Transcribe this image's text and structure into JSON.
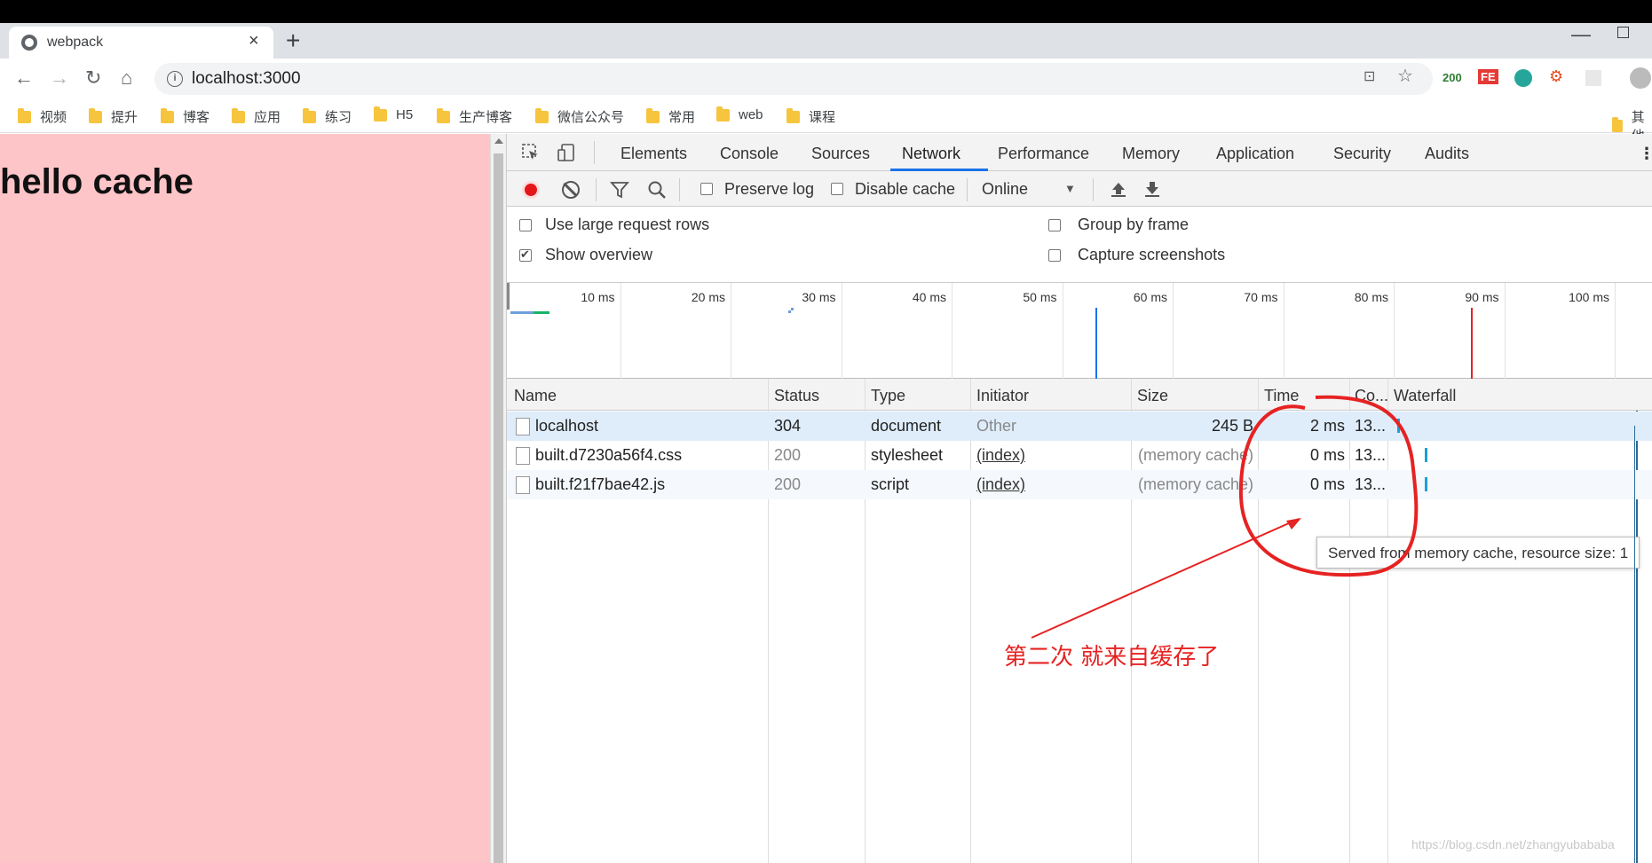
{
  "browser": {
    "tab_title": "webpack",
    "tab_close": "×",
    "new_tab": "+",
    "url": "localhost:3000",
    "ext_count": "200",
    "ext_fe": "FE"
  },
  "bookmarks": [
    "视频",
    "提升",
    "博客",
    "应用",
    "练习",
    "H5",
    "生产博客",
    "微信公众号",
    "常用",
    "web",
    "课程"
  ],
  "bookmark_overflow": "其他",
  "page": {
    "heading": "hello cache"
  },
  "devtools": {
    "tabs": [
      "Elements",
      "Console",
      "Sources",
      "Network",
      "Performance",
      "Memory",
      "Application",
      "Security",
      "Audits"
    ],
    "active_tab": "Network",
    "more": "⋮",
    "network_toolbar": {
      "preserve_log": "Preserve log",
      "disable_cache": "Disable cache",
      "throttle": "Online",
      "throttle_arrow": "▼"
    },
    "options": {
      "large_rows": "Use large request rows",
      "group_by_frame": "Group by frame",
      "show_overview": "Show overview",
      "capture_screenshots": "Capture screenshots",
      "show_overview_checked": true
    },
    "overview_ticks": [
      "10 ms",
      "20 ms",
      "30 ms",
      "40 ms",
      "50 ms",
      "60 ms",
      "70 ms",
      "80 ms",
      "90 ms",
      "100 ms"
    ],
    "overview_markers": {
      "dom_content_loaded_ms": 53,
      "load_ms": 87,
      "colors": {
        "dcl": "#1a73e8",
        "load": "#e62222"
      }
    },
    "columns": [
      "Name",
      "Status",
      "Type",
      "Initiator",
      "Size",
      "Time",
      "Co...",
      "Waterfall"
    ],
    "requests": [
      {
        "name": "localhost",
        "status": "304",
        "type": "document",
        "initiator": "Other",
        "size": "245 B",
        "time": "2 ms",
        "connection": "13..."
      },
      {
        "name": "built.d7230a56f4.css",
        "status": "200",
        "type": "stylesheet",
        "initiator": "(index)",
        "size": "(memory cache)",
        "time": "0 ms",
        "connection": "13..."
      },
      {
        "name": "built.f21f7bae42.js",
        "status": "200",
        "type": "script",
        "initiator": "(index)",
        "size": "(memory cache)",
        "time": "0 ms",
        "connection": "13..."
      }
    ],
    "tooltip": "Served from memory cache, resource size: 1"
  },
  "annotation": "第二次  就来自缓存了",
  "annotation_color": "#e62222",
  "watermark": "https://blog.csdn.net/zhangyubababa",
  "colors": {
    "page_bg": "#fec5c8",
    "record": "#e5161a",
    "accent": "#1a73e8"
  }
}
